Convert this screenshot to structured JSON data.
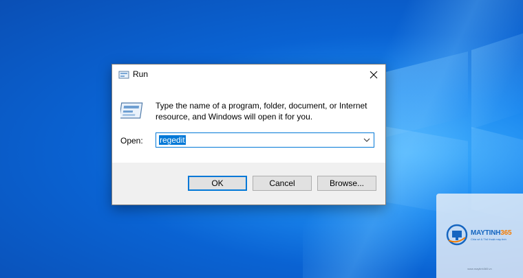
{
  "dialog": {
    "title": "Run",
    "description": "Type the name of a program, folder, document, or Internet resource, and Windows will open it for you.",
    "open_label": "Open:",
    "open_value": "regedit",
    "buttons": {
      "ok": "OK",
      "cancel": "Cancel",
      "browse": "Browse..."
    }
  },
  "watermark": {
    "brand_a": "MAYTINH",
    "brand_b": "365",
    "tagline": "Chia sẻ & Thủ thuật máy tính",
    "url": "www.maytinh365.vn"
  },
  "colors": {
    "accent": "#0078d7",
    "desktop": "#0a63d3"
  }
}
